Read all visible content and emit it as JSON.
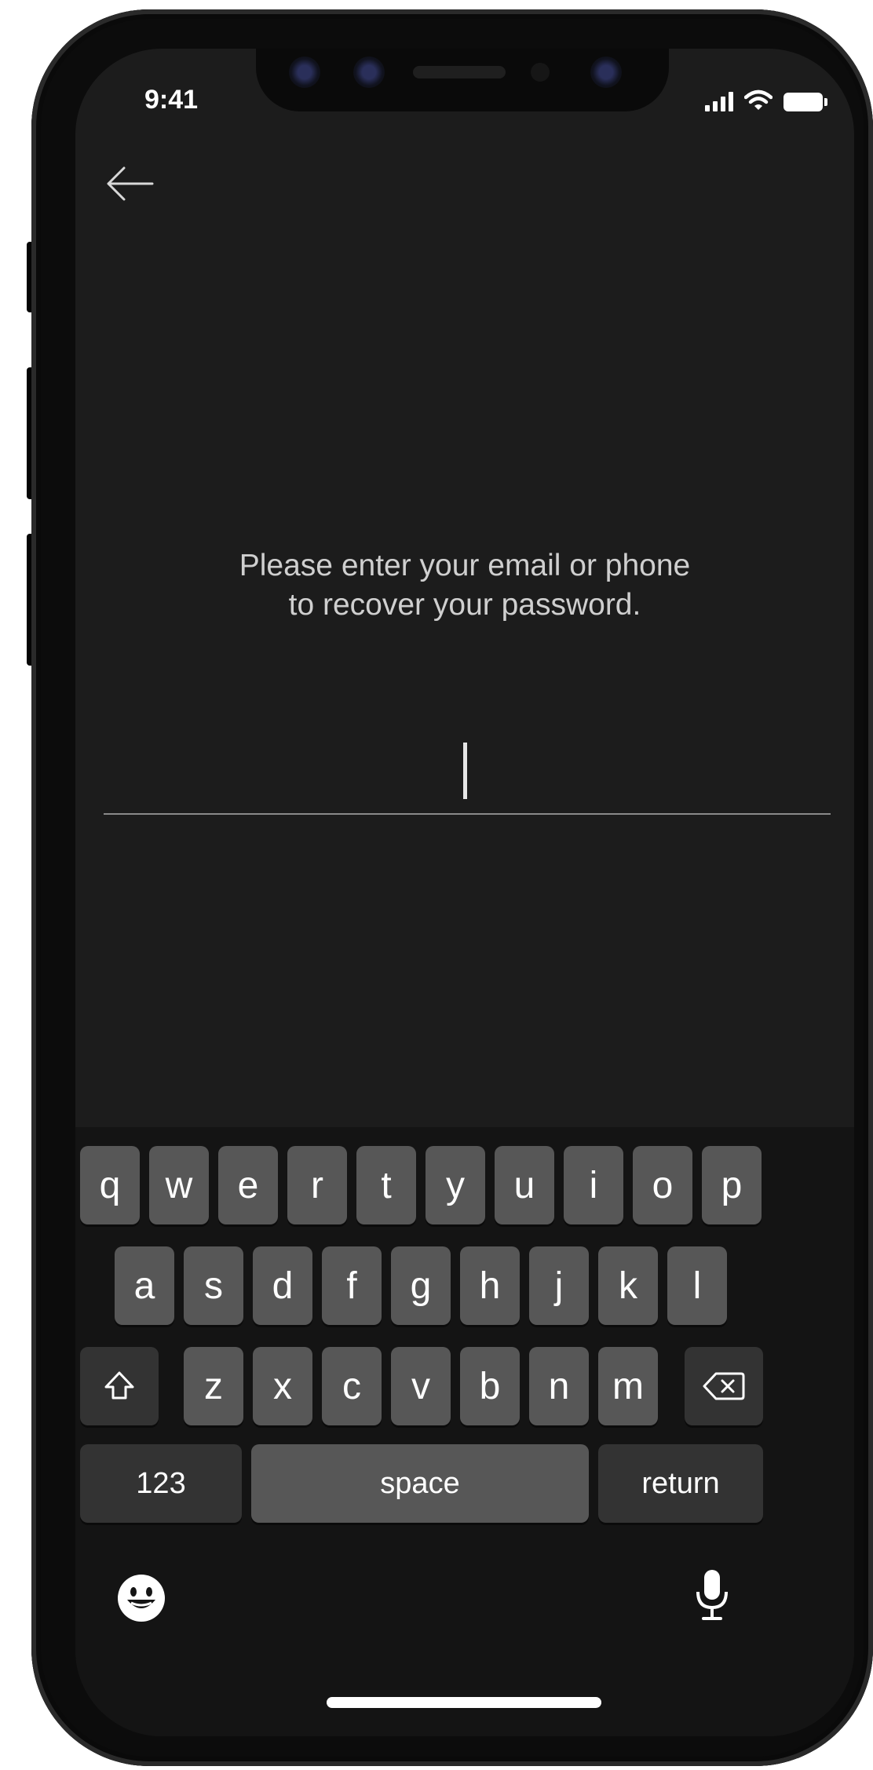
{
  "status_bar": {
    "time": "9:41"
  },
  "header": {
    "back_icon": "arrow-left-icon"
  },
  "recovery": {
    "prompt_line1": "Please enter your email or phone",
    "prompt_line2": "to recover your password.",
    "input_value": ""
  },
  "keyboard": {
    "row1": [
      "q",
      "w",
      "e",
      "r",
      "t",
      "y",
      "u",
      "i",
      "o",
      "p"
    ],
    "row2": [
      "a",
      "s",
      "d",
      "f",
      "g",
      "h",
      "j",
      "k",
      "l"
    ],
    "row3": [
      "z",
      "x",
      "c",
      "v",
      "b",
      "n",
      "m"
    ],
    "numbers_label": "123",
    "space_label": "space",
    "return_label": "return",
    "shift_icon": "shift-icon",
    "delete_icon": "delete-icon",
    "emoji_icon": "emoji-icon",
    "mic_icon": "microphone-icon"
  },
  "colors": {
    "screen_bg": "#1c1c1c",
    "keyboard_bg": "#141414",
    "key_bg": "#575757",
    "key_dark_bg": "#333333",
    "text_primary": "#ffffff",
    "text_secondary": "#cfcfcf"
  }
}
